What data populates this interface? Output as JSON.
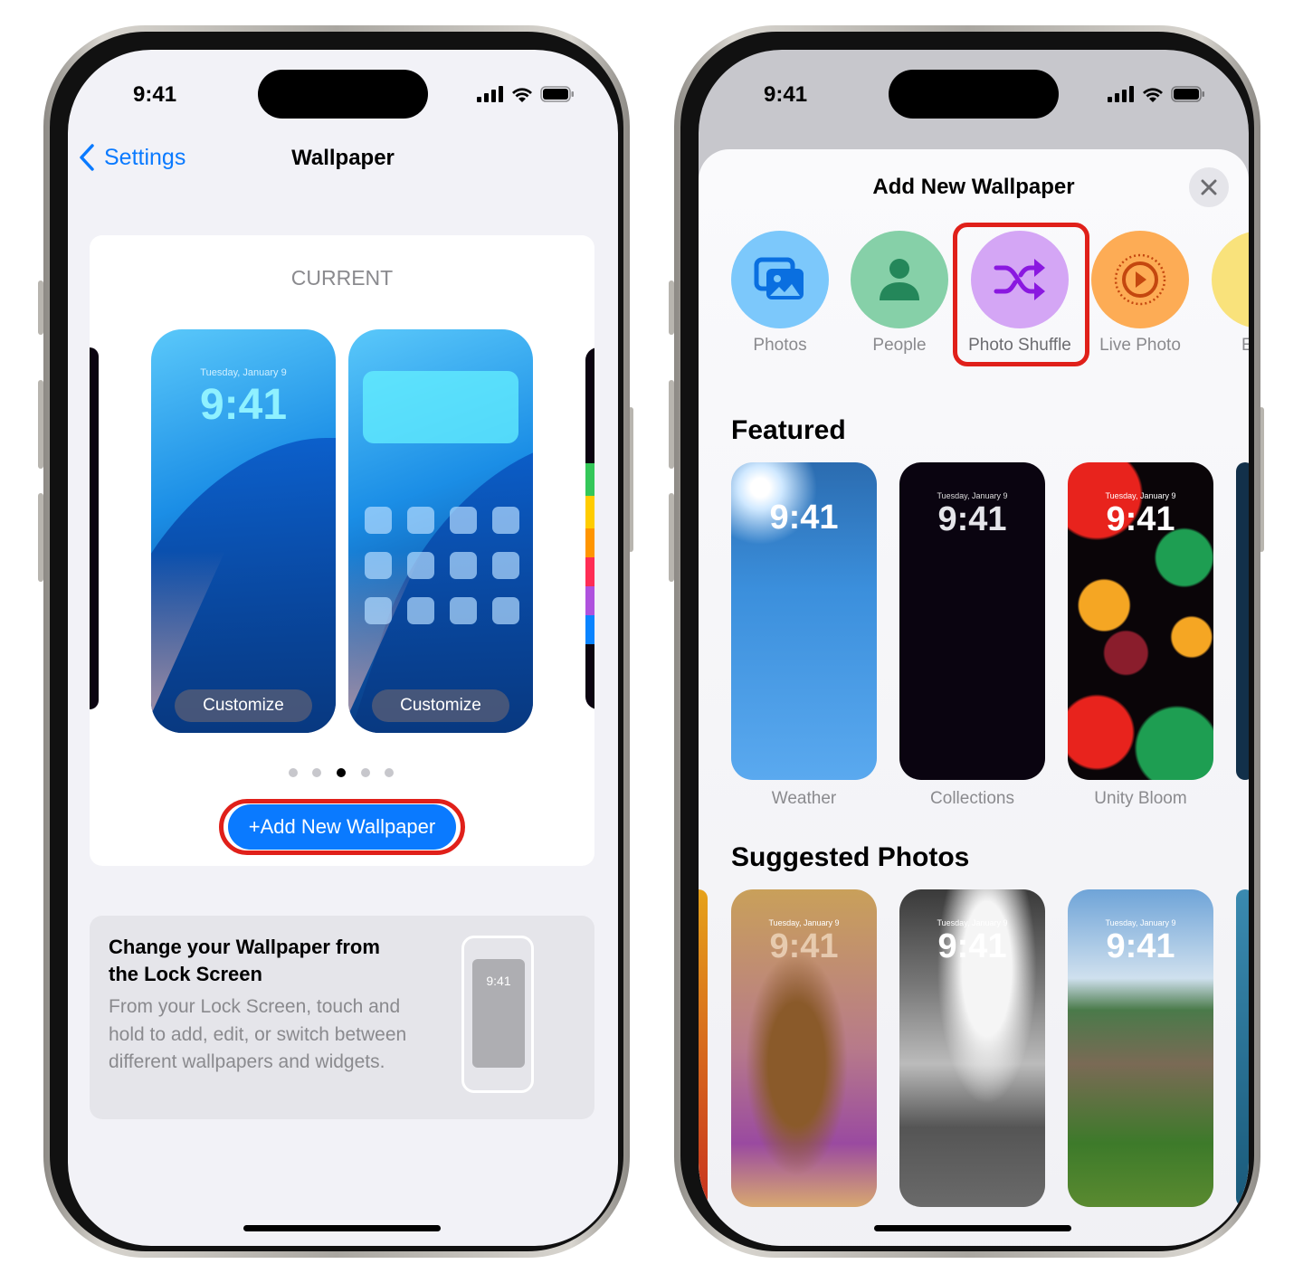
{
  "left_phone": {
    "status": {
      "time": "9:41"
    },
    "nav": {
      "back_label": "Settings",
      "title": "Wallpaper"
    },
    "current": {
      "heading": "CURRENT",
      "lock_preview": {
        "date": "Tuesday, January 9",
        "time": "9:41",
        "button": "Customize"
      },
      "home_preview": {
        "button": "Customize"
      },
      "page_dots": {
        "count": 5,
        "active": 3
      }
    },
    "add_button": "+Add New Wallpaper",
    "info": {
      "title": "Change your Wallpaper from the Lock Screen",
      "body": "From your Lock Screen, touch and hold to add, edit, or switch between different wallpapers and widgets.",
      "illustration_time": "9:41"
    }
  },
  "right_phone": {
    "status": {
      "time": "9:41"
    },
    "sheet": {
      "title": "Add New Wallpaper",
      "close": "close-icon"
    },
    "categories": [
      {
        "label": "Photos",
        "icon": "photos-icon",
        "color": "#7cc8fb"
      },
      {
        "label": "People",
        "icon": "person-icon",
        "color": "#86d0a8"
      },
      {
        "label": "Photo Shuffle",
        "icon": "shuffle-icon",
        "color": "#d4a6f5",
        "highlighted": true
      },
      {
        "label": "Live Photo",
        "icon": "live-photo-icon",
        "color": "#fdac55"
      },
      {
        "label": "E",
        "icon": "emoji-icon",
        "color": "#f9e27b"
      }
    ],
    "featured": {
      "heading": "Featured",
      "items": [
        {
          "label": "Weather",
          "time": "9:41",
          "date": ""
        },
        {
          "label": "Collections",
          "time": "9:41",
          "date": "Tuesday, January 9"
        },
        {
          "label": "Unity Bloom",
          "time": "9:41",
          "date": "Tuesday, January 9"
        }
      ]
    },
    "suggested": {
      "heading": "Suggested Photos",
      "items": [
        {
          "time": "9:41",
          "date": "Tuesday, January 9"
        },
        {
          "time": "9:41",
          "date": "Tuesday, January 9"
        },
        {
          "time": "9:41",
          "date": "Tuesday, January 9"
        }
      ]
    }
  },
  "colors": {
    "accent": "#0a7aff",
    "highlight": "#e0201a"
  }
}
